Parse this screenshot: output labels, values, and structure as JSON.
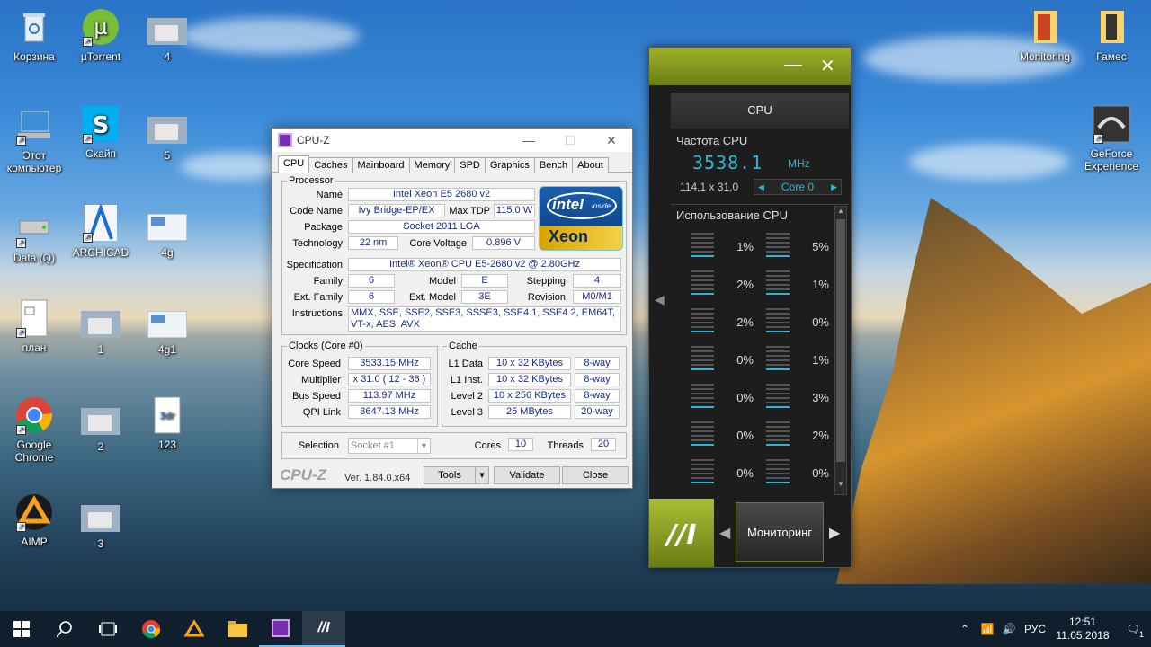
{
  "desktop": {
    "icons": [
      {
        "label": "Корзина"
      },
      {
        "label": "µTorrent"
      },
      {
        "label": "4"
      },
      {
        "label": "Этот компьютер"
      },
      {
        "label": "Скайп"
      },
      {
        "label": "5"
      },
      {
        "label": "Data (Q)"
      },
      {
        "label": "ARCHICAD"
      },
      {
        "label": "4g"
      },
      {
        "label": "план"
      },
      {
        "label": "1"
      },
      {
        "label": "4g1"
      },
      {
        "label": "Google Chrome"
      },
      {
        "label": "2"
      },
      {
        "label": "123"
      },
      {
        "label": "AIMP"
      },
      {
        "label": "3"
      },
      {
        "label": "Monitoring"
      },
      {
        "label": "Гамес"
      },
      {
        "label": "GeForce Experience"
      }
    ]
  },
  "cpuz": {
    "title": "CPU-Z",
    "tabs": [
      "CPU",
      "Caches",
      "Mainboard",
      "Memory",
      "SPD",
      "Graphics",
      "Bench",
      "About"
    ],
    "processor": {
      "legend": "Processor",
      "name_label": "Name",
      "name": "Intel Xeon E5 2680 v2",
      "codename_label": "Code Name",
      "codename": "Ivy Bridge-EP/EX",
      "maxtdp_label": "Max TDP",
      "maxtdp": "115.0 W",
      "package_label": "Package",
      "package": "Socket 2011 LGA",
      "technology_label": "Technology",
      "technology": "22 nm",
      "voltage_label": "Core Voltage",
      "voltage": "0.896 V",
      "spec_label": "Specification",
      "spec": "Intel® Xeon® CPU E5-2680 v2 @ 2.80GHz",
      "family_label": "Family",
      "family": "6",
      "model_label": "Model",
      "model": "E",
      "stepping_label": "Stepping",
      "stepping": "4",
      "extfamily_label": "Ext. Family",
      "extfamily": "6",
      "extmodel_label": "Ext. Model",
      "extmodel": "3E",
      "revision_label": "Revision",
      "revision": "M0/M1",
      "instr_label": "Instructions",
      "instr": "MMX, SSE, SSE2, SSE3, SSSE3, SSE4.1, SSE4.2, EM64T, VT-x, AES, AVX"
    },
    "logo": {
      "intel": "intel",
      "inside": "inside",
      "xeon": "Xeon"
    },
    "clocks": {
      "legend": "Clocks (Core #0)",
      "corespeed_label": "Core Speed",
      "corespeed": "3533.15 MHz",
      "multiplier_label": "Multiplier",
      "multiplier": "x 31.0 ( 12 - 36 )",
      "busspeed_label": "Bus Speed",
      "busspeed": "113.97 MHz",
      "qpi_label": "QPI Link",
      "qpi": "3647.13 MHz"
    },
    "cache": {
      "legend": "Cache",
      "rows": [
        {
          "label": "L1 Data",
          "size": "10 x 32 KBytes",
          "way": "8-way"
        },
        {
          "label": "L1 Inst.",
          "size": "10 x 32 KBytes",
          "way": "8-way"
        },
        {
          "label": "Level 2",
          "size": "10 x 256 KBytes",
          "way": "8-way"
        },
        {
          "label": "Level 3",
          "size": "25 MBytes",
          "way": "20-way"
        }
      ]
    },
    "selection_label": "Selection",
    "selection": "Socket #1",
    "cores_label": "Cores",
    "cores": "10",
    "threads_label": "Threads",
    "threads": "20",
    "brand": "CPU-Z",
    "version": "Ver. 1.84.0.x64",
    "tools": "Tools",
    "validate": "Validate",
    "close": "Close"
  },
  "monitor": {
    "header": "CPU",
    "freq_label": "Частота CPU",
    "freq": "3538.1",
    "freq_unit": "MHz",
    "bus": "114,1 x 31,0",
    "core": "Core 0",
    "usage_label": "Использование CPU",
    "usage_left": [
      "1%",
      "2%",
      "2%",
      "0%",
      "0%",
      "0%",
      "0%"
    ],
    "usage_right": [
      "5%",
      "1%",
      "0%",
      "1%",
      "3%",
      "2%",
      "0%"
    ],
    "mode": "Мониторинг",
    "accent": "#2bb6d4"
  },
  "taskbar": {
    "lang": "РУС",
    "time": "12:51",
    "date": "11.05.2018",
    "notif": "1"
  }
}
